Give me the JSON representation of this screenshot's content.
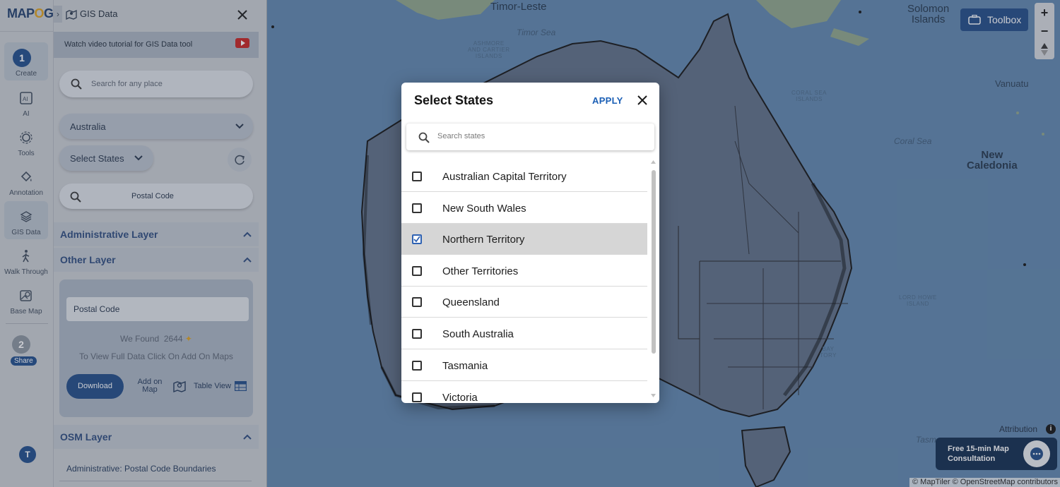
{
  "app": {
    "logo_text": "MAPOG",
    "panel_title": "GIS Data"
  },
  "rail": {
    "items": [
      {
        "label": "Create",
        "step": "1"
      },
      {
        "label": "AI"
      },
      {
        "label": "Tools"
      },
      {
        "label": "Annotation"
      },
      {
        "label": "GIS Data"
      },
      {
        "label": "Walk Through"
      },
      {
        "label": "Base Map"
      }
    ],
    "share_step": "2",
    "share_label": "Share",
    "avatar_initial": "T"
  },
  "panel": {
    "tutorial_text": "Watch video tutorial for GIS Data tool",
    "search_placeholder": "Search for any place",
    "country": "Australia",
    "states_label": "Select States",
    "postal_placeholder": "Postal Code",
    "sections": {
      "administrative": "Administrative Layer",
      "other": "Other Layer",
      "osm": "OSM Layer"
    },
    "card": {
      "input_value": "Postal Code",
      "found_prefix": "We Found",
      "found_count": "2644",
      "view_hint": "To View Full Data Click On Add On Maps",
      "download_label": "Download",
      "add_on_map_line1": "Add on",
      "add_on_map_line2": "Map",
      "table_view_label": "Table View"
    },
    "osm_link": "Administrative: Postal Code Boundaries"
  },
  "map": {
    "labels": {
      "timor_leste": "Timor-Leste",
      "timor_sea": "Timor Sea",
      "ashmore": [
        "ASHMORE",
        "AND CARTIER",
        "ISLANDS"
      ],
      "solomon": [
        "Solomon",
        "Islands"
      ],
      "vanuatu": "Vanuatu",
      "coral_sea_islands": [
        "CORAL SEA",
        "ISLANDS"
      ],
      "coral_sea": "Coral Sea",
      "new_caledonia": [
        "New",
        "Caledonia"
      ],
      "lord_howe": [
        "LORD HOWE",
        "ISLAND"
      ],
      "bay": [
        "BAY",
        "TORY"
      ],
      "tasman": "Tasm"
    },
    "toolbox_label": "Toolbox",
    "zoom_in": "+",
    "zoom_out": "−",
    "attribution": "Attribution",
    "consult_line1": "Free 15-min Map",
    "consult_line2": "Consultation",
    "copyright": "© MapTiler © OpenStreetMap contributors"
  },
  "modal": {
    "title": "Select States",
    "apply_label": "APPLY",
    "search_placeholder": "Search states",
    "states": [
      {
        "name": "Australian Capital Territory",
        "checked": false
      },
      {
        "name": "New South Wales",
        "checked": false
      },
      {
        "name": "Northern Territory",
        "checked": true
      },
      {
        "name": "Other Territories",
        "checked": false
      },
      {
        "name": "Queensland",
        "checked": false
      },
      {
        "name": "South Australia",
        "checked": false
      },
      {
        "name": "Tasmania",
        "checked": false
      },
      {
        "name": "Victoria",
        "checked": false
      }
    ]
  },
  "colors": {
    "brand_blue": "#1f4a86",
    "apply_blue": "#1b5fb5",
    "checked_row": "#d6d6d6",
    "map_water": "#5f86ad",
    "land": "#5d6e85"
  }
}
